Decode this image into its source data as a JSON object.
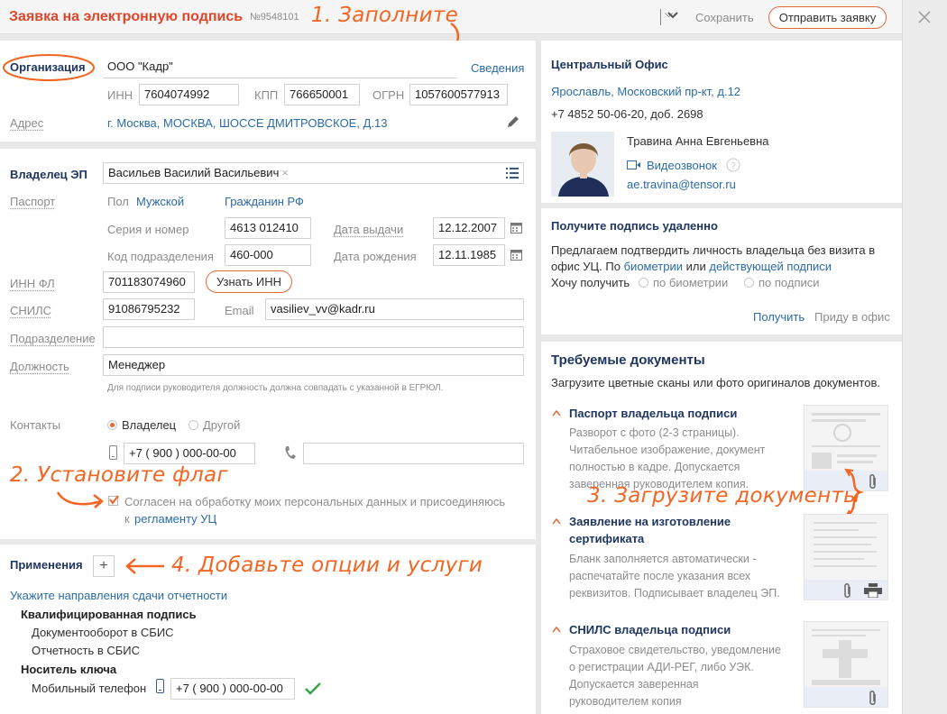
{
  "header": {
    "title": "Заявка на электронную подпись",
    "number": "№9548101",
    "save": "Сохранить",
    "send": "Отправить заявку",
    "close_icon": "close-icon"
  },
  "hints": {
    "h1": "1. Заполните",
    "h2": "2. Установите флаг",
    "h3": "3. Загрузите документы",
    "h4": "4. Добавьте опции и услуги"
  },
  "org": {
    "label": "Организация",
    "name": "ООО \"Кадр\"",
    "info_link": "Сведения",
    "inn_label": "ИНН",
    "inn": "7604074992",
    "kpp_label": "КПП",
    "kpp": "766650001",
    "ogrn_label": "ОГРН",
    "ogrn": "1057600577913",
    "address_label": "Адрес",
    "address": "г. Москва, МОСКВА, ШОССЕ ДМИТРОВСКОЕ, Д.13"
  },
  "owner": {
    "label": "Владелец ЭП",
    "name": "Васильев Василий Васильевич",
    "passport_label": "Паспорт",
    "sex_label": "Пол",
    "sex": "Мужской",
    "citizenship": "Гражданин РФ",
    "series_label": "Серия и номер",
    "series": "4613 012410",
    "issue_label": "Дата выдачи",
    "issue_date": "12.12.2007",
    "code_label": "Код подразделения",
    "code": "460-000",
    "birth_label": "Дата рождения",
    "birth_date": "12.11.1985",
    "inn_label": "ИНН ФЛ",
    "inn": "701183074960",
    "inn_button": "Узнать ИНН",
    "snils_label": "СНИЛС",
    "snils": "91086795232",
    "email_label": "Email",
    "email": "vasiliev_vv@kadr.ru",
    "dept_label": "Подразделение",
    "dept": "",
    "position_label": "Должность",
    "position": "Менеджер",
    "position_hint": "Для подписи руководителя должность должна совпадать с указанной в ЕГРЮЛ.",
    "contacts_label": "Контакты",
    "contact_owner": "Владелец",
    "contact_other": "Другой",
    "phone": "+7 ( 900 ) 000-00-00",
    "phone2": "",
    "consent_text": "Согласен на обработку моих персональных данных и присоединяюсь",
    "consent_prefix": "к",
    "consent_link": "регламенту УЦ"
  },
  "apps": {
    "label": "Применения",
    "add": "+",
    "report_link": "Укажите направления сдачи отчетности",
    "qual": "Квалифицированная подпись",
    "item1": "Документооборот в СБИС",
    "item2": "Отчетность в СБИС",
    "carrier": "Носитель ключа",
    "mobile_label": "Мобильный телефон",
    "mobile": "+7 ( 900 ) 000-00-00"
  },
  "office": {
    "title": "Центральный Офис",
    "address": "Ярославль, Московский пр-кт, д.12",
    "phone": "+7 4852 50-06-20, доб. 2698",
    "manager": "Травина Анна Евгеньевна",
    "video": "Видеозвонок",
    "email": "ae.travina@tensor.ru"
  },
  "remote": {
    "title": "Получите подпись удаленно",
    "text1": "Предлагаем подтвердить личность владельца без визита в",
    "text2_a": "офис УЦ. По",
    "text2_link1": "биометрии",
    "text2_b": "или",
    "text2_link2": "действующей подписи",
    "want": "Хочу получить",
    "opt1": "по биометрии",
    "opt2": "по подписи",
    "get": "Получить",
    "office": "Приду в офис"
  },
  "docs": {
    "title": "Требуемые документы",
    "subtitle": "Загрузите цветные сканы или фото оригиналов документов.",
    "d1_title": "Паспорт владельца подписи",
    "d1_l1": "Разворот с фото (2-3 страницы).",
    "d1_l2": "Читабельное изображение, документ",
    "d1_l3": "полностью в кадре. Допускается",
    "d1_l4": "заверенная руководителем копия.",
    "d2_t1": "Заявление на изготовление",
    "d2_t2": "сертификата",
    "d2_l1": "Бланк заполняется автоматически -",
    "d2_l2": "распечатайте после указания всех",
    "d2_l3": "реквизитов. Подписывает владелец ЭП.",
    "d3_title": "СНИЛС владельца подписи",
    "d3_l1": "Страховое свидетельство, уведомление",
    "d3_l2": "о регистрации АДИ-РЕГ, либо УЭК.",
    "d3_l3": "Допускается заверенная",
    "d3_l4": "руководителем копия"
  }
}
